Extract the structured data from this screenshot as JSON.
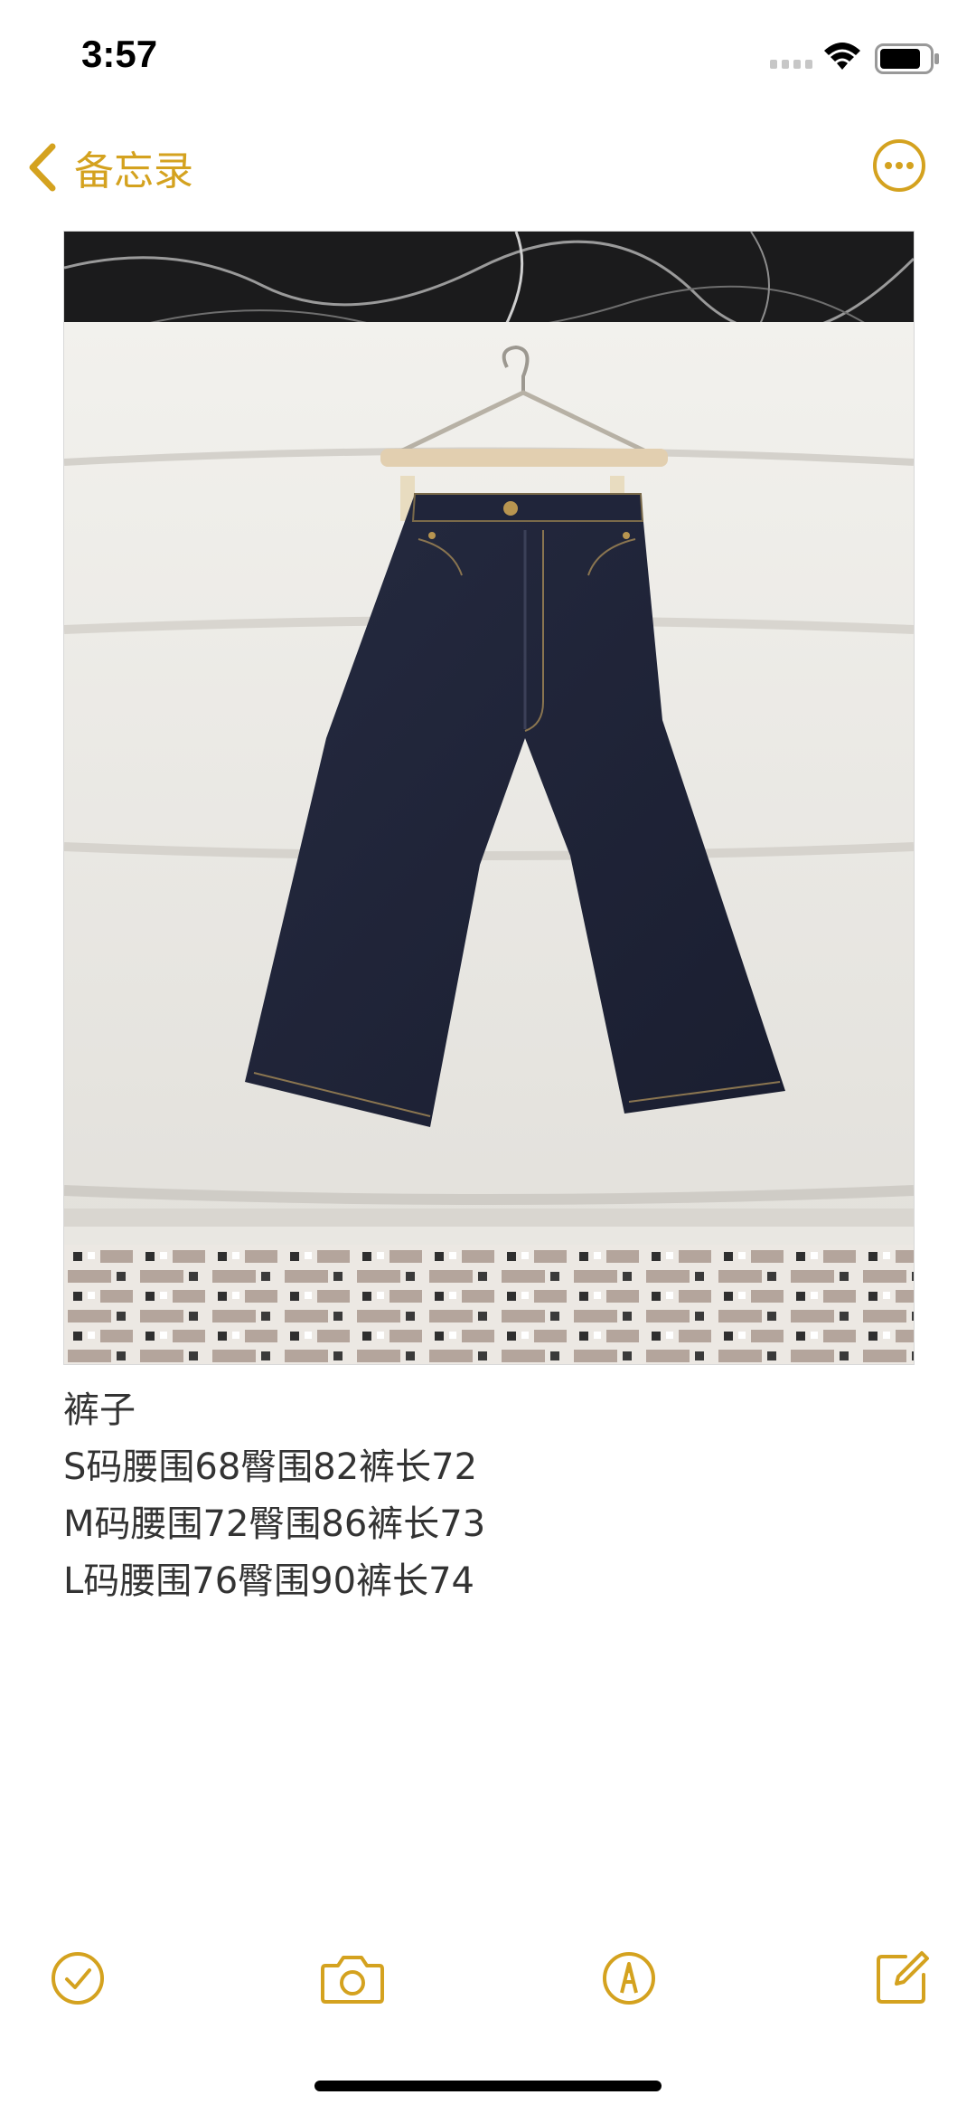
{
  "status_bar": {
    "time": "3:57"
  },
  "nav": {
    "back_label": "备忘录",
    "accent_color": "#d4a21f"
  },
  "photo": {
    "description_icon": "photo-attachment"
  },
  "note": {
    "lines": [
      "裤子",
      "S码腰围68臀围82裤长72",
      "M码腰围72臀围86裤长73",
      "L码腰围76臀围90裤长74"
    ]
  },
  "toolbar": {
    "icons": [
      "checklist-icon",
      "camera-icon",
      "markup-pen-icon",
      "compose-icon"
    ]
  }
}
